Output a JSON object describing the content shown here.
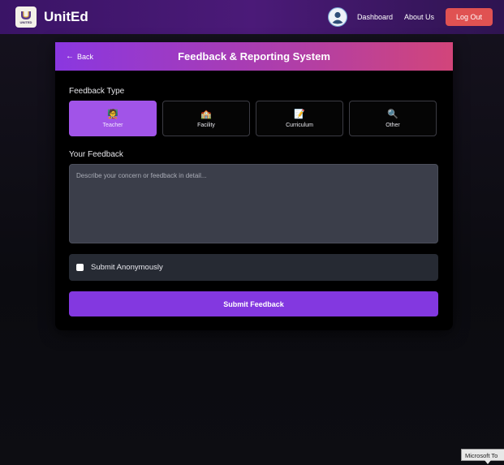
{
  "navbar": {
    "logo_text": "UNITED",
    "brand": "UnitEd",
    "links": [
      "Dashboard",
      "About Us"
    ],
    "logout_label": "Log Out"
  },
  "card": {
    "back_label": "Back",
    "title": "Feedback & Reporting System",
    "feedback_type_label": "Feedback Type",
    "types": [
      {
        "icon": "🧑‍🏫",
        "label": "Teacher",
        "selected": true
      },
      {
        "icon": "🏫",
        "label": "Facility",
        "selected": false
      },
      {
        "icon": "📝",
        "label": "Curriculum",
        "selected": false
      },
      {
        "icon": "🔍",
        "label": "Other",
        "selected": false
      }
    ],
    "your_feedback_label": "Your Feedback",
    "feedback_placeholder": "Describe your concern or feedback in detail...",
    "anonymous_label": "Submit Anonymously",
    "submit_label": "Submit Feedback"
  },
  "tooltip": "Microsoft To",
  "colors": {
    "accent": "#8338e0",
    "selected_type": "#a154e8",
    "logout": "#e05252"
  }
}
